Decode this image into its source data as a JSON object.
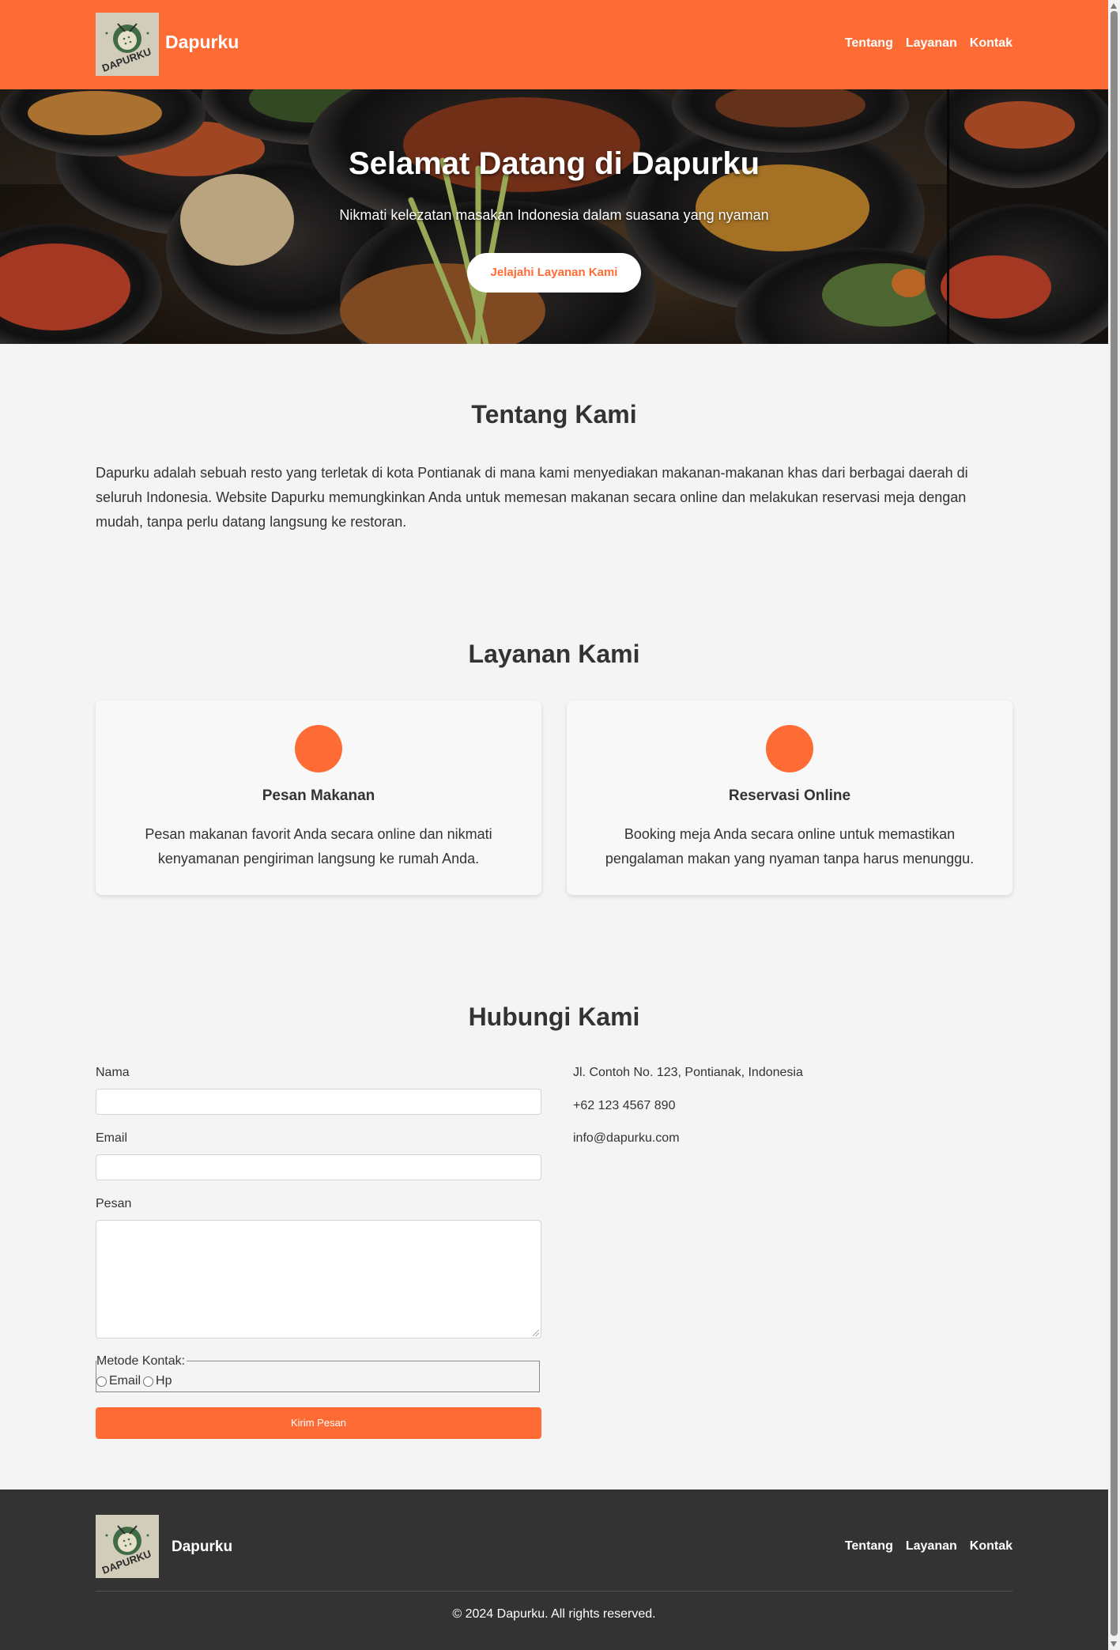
{
  "header": {
    "brand": "Dapurku",
    "logo_text": "DAPURKU",
    "nav": [
      "Tentang",
      "Layanan",
      "Kontak"
    ]
  },
  "hero": {
    "title": "Selamat Datang di Dapurku",
    "subtitle": "Nikmati kelezatan masakan Indonesia dalam suasana yang nyaman",
    "cta": "Jelajahi Layanan Kami"
  },
  "about": {
    "title": "Tentang Kami",
    "text": "Dapurku adalah sebuah resto yang terletak di kota Pontianak di mana kami menyediakan makanan-makanan khas dari berbagai daerah di seluruh Indonesia. Website Dapurku memungkinkan Anda untuk memesan makanan secara online dan melakukan reservasi meja dengan mudah, tanpa perlu datang langsung ke restoran."
  },
  "services": {
    "title": "Layanan Kami",
    "items": [
      {
        "title": "Pesan Makanan",
        "desc": "Pesan makanan favorit Anda secara online dan nikmati kenyamanan pengiriman langsung ke rumah Anda."
      },
      {
        "title": "Reservasi Online",
        "desc": "Booking meja Anda secara online untuk memastikan pengalaman makan yang nyaman tanpa harus menunggu."
      }
    ]
  },
  "contact": {
    "title": "Hubungi Kami",
    "form": {
      "name_label": "Nama",
      "email_label": "Email",
      "message_label": "Pesan",
      "method_legend": "Metode Kontak:",
      "method_options": [
        "Email",
        "Hp"
      ],
      "submit": "Kirim Pesan"
    },
    "info": {
      "address": "Jl. Contoh No. 123, Pontianak, Indonesia",
      "phone": "+62 123 4567 890",
      "email": "info@dapurku.com"
    }
  },
  "footer": {
    "brand": "Dapurku",
    "nav": [
      "Tentang",
      "Layanan",
      "Kontak"
    ],
    "copyright": "© 2024 Dapurku. All rights reserved."
  },
  "colors": {
    "accent": "#ff6b35",
    "footer_bg": "#333333",
    "page_bg": "#f4f4f4"
  }
}
